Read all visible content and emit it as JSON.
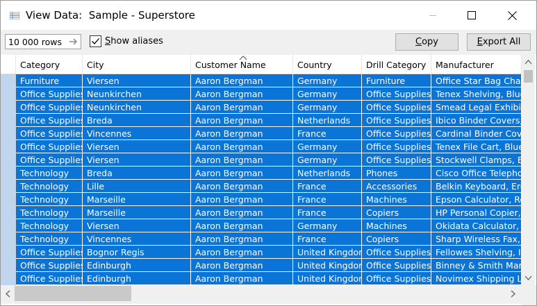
{
  "window": {
    "title": "View Data:  Sample - Superstore"
  },
  "toolbar": {
    "rows_value": "10 000 rows",
    "show_aliases_checked": true,
    "show_aliases_prefix": "",
    "show_aliases_underlined": "S",
    "show_aliases_rest": "how aliases",
    "copy_underlined": "C",
    "copy_rest": "opy",
    "export_underlined": "E",
    "export_rest": "xport All"
  },
  "table": {
    "columns": [
      "Category",
      "City",
      "Customer Name",
      "Country",
      "Drill Category",
      "Manufacturer"
    ],
    "sorted_column": "Customer Name",
    "rows": [
      [
        "Furniture",
        "Viersen",
        "Aaron Bergman",
        "Germany",
        "Furniture",
        "Office Star Bag Chair"
      ],
      [
        "Office Supplies",
        "Neunkirchen",
        "Aaron Bergman",
        "Germany",
        "Office Supplies",
        "Tenex Shelving, Blue"
      ],
      [
        "Office Supplies",
        "Neunkirchen",
        "Aaron Bergman",
        "Germany",
        "Office Supplies",
        "Smead Legal Exhibit Labels"
      ],
      [
        "Office Supplies",
        "Breda",
        "Aaron Bergman",
        "Netherlands",
        "Office Supplies",
        "Ibico Binder Covers, Clear"
      ],
      [
        "Office Supplies",
        "Vincennes",
        "Aaron Bergman",
        "France",
        "Office Supplies",
        "Cardinal Binder Covers"
      ],
      [
        "Office Supplies",
        "Viersen",
        "Aaron Bergman",
        "Germany",
        "Office Supplies",
        "Tenex File Cart, Blue"
      ],
      [
        "Office Supplies",
        "Viersen",
        "Aaron Bergman",
        "Germany",
        "Office Supplies",
        "Stockwell Clamps, Bulk"
      ],
      [
        "Technology",
        "Breda",
        "Aaron Bergman",
        "Netherlands",
        "Phones",
        "Cisco Office Telephone"
      ],
      [
        "Technology",
        "Lille",
        "Aaron Bergman",
        "France",
        "Accessories",
        "Belkin Keyboard, Ergonomic"
      ],
      [
        "Technology",
        "Marseille",
        "Aaron Bergman",
        "France",
        "Machines",
        "Epson Calculator, Red"
      ],
      [
        "Technology",
        "Marseille",
        "Aaron Bergman",
        "France",
        "Copiers",
        "HP Personal Copier, Digital"
      ],
      [
        "Technology",
        "Viersen",
        "Aaron Bergman",
        "Germany",
        "Machines",
        "Okidata Calculator, Digital"
      ],
      [
        "Technology",
        "Vincennes",
        "Aaron Bergman",
        "France",
        "Copiers",
        "Sharp Wireless Fax, Digital"
      ],
      [
        "Office Supplies",
        "Bognor Regis",
        "Aaron Bergman",
        "United Kingdom",
        "Office Supplies",
        "Fellowes Shelving, Industrial"
      ],
      [
        "Office Supplies",
        "Edinburgh",
        "Aaron Bergman",
        "United Kingdom",
        "Office Supplies",
        "Binney & Smith Markers"
      ],
      [
        "Office Supplies",
        "Edinburgh",
        "Aaron Bergman",
        "United Kingdom",
        "Office Supplies",
        "Novimex Shipping Labels"
      ]
    ]
  },
  "colors": {
    "selection": "#0a75d6",
    "row_header": "#bfd6ee"
  }
}
